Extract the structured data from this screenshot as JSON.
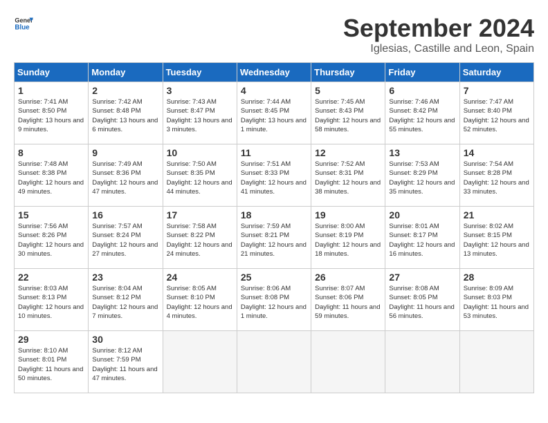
{
  "logo": {
    "line1": "General",
    "line2": "Blue"
  },
  "title": "September 2024",
  "location": "Iglesias, Castille and Leon, Spain",
  "days_of_week": [
    "Sunday",
    "Monday",
    "Tuesday",
    "Wednesday",
    "Thursday",
    "Friday",
    "Saturday"
  ],
  "weeks": [
    [
      {
        "day": "1",
        "sunrise": "7:41 AM",
        "sunset": "8:50 PM",
        "daylight": "13 hours and 9 minutes."
      },
      {
        "day": "2",
        "sunrise": "7:42 AM",
        "sunset": "8:48 PM",
        "daylight": "13 hours and 6 minutes."
      },
      {
        "day": "3",
        "sunrise": "7:43 AM",
        "sunset": "8:47 PM",
        "daylight": "13 hours and 3 minutes."
      },
      {
        "day": "4",
        "sunrise": "7:44 AM",
        "sunset": "8:45 PM",
        "daylight": "13 hours and 1 minute."
      },
      {
        "day": "5",
        "sunrise": "7:45 AM",
        "sunset": "8:43 PM",
        "daylight": "12 hours and 58 minutes."
      },
      {
        "day": "6",
        "sunrise": "7:46 AM",
        "sunset": "8:42 PM",
        "daylight": "12 hours and 55 minutes."
      },
      {
        "day": "7",
        "sunrise": "7:47 AM",
        "sunset": "8:40 PM",
        "daylight": "12 hours and 52 minutes."
      }
    ],
    [
      {
        "day": "8",
        "sunrise": "7:48 AM",
        "sunset": "8:38 PM",
        "daylight": "12 hours and 49 minutes."
      },
      {
        "day": "9",
        "sunrise": "7:49 AM",
        "sunset": "8:36 PM",
        "daylight": "12 hours and 47 minutes."
      },
      {
        "day": "10",
        "sunrise": "7:50 AM",
        "sunset": "8:35 PM",
        "daylight": "12 hours and 44 minutes."
      },
      {
        "day": "11",
        "sunrise": "7:51 AM",
        "sunset": "8:33 PM",
        "daylight": "12 hours and 41 minutes."
      },
      {
        "day": "12",
        "sunrise": "7:52 AM",
        "sunset": "8:31 PM",
        "daylight": "12 hours and 38 minutes."
      },
      {
        "day": "13",
        "sunrise": "7:53 AM",
        "sunset": "8:29 PM",
        "daylight": "12 hours and 35 minutes."
      },
      {
        "day": "14",
        "sunrise": "7:54 AM",
        "sunset": "8:28 PM",
        "daylight": "12 hours and 33 minutes."
      }
    ],
    [
      {
        "day": "15",
        "sunrise": "7:56 AM",
        "sunset": "8:26 PM",
        "daylight": "12 hours and 30 minutes."
      },
      {
        "day": "16",
        "sunrise": "7:57 AM",
        "sunset": "8:24 PM",
        "daylight": "12 hours and 27 minutes."
      },
      {
        "day": "17",
        "sunrise": "7:58 AM",
        "sunset": "8:22 PM",
        "daylight": "12 hours and 24 minutes."
      },
      {
        "day": "18",
        "sunrise": "7:59 AM",
        "sunset": "8:21 PM",
        "daylight": "12 hours and 21 minutes."
      },
      {
        "day": "19",
        "sunrise": "8:00 AM",
        "sunset": "8:19 PM",
        "daylight": "12 hours and 18 minutes."
      },
      {
        "day": "20",
        "sunrise": "8:01 AM",
        "sunset": "8:17 PM",
        "daylight": "12 hours and 16 minutes."
      },
      {
        "day": "21",
        "sunrise": "8:02 AM",
        "sunset": "8:15 PM",
        "daylight": "12 hours and 13 minutes."
      }
    ],
    [
      {
        "day": "22",
        "sunrise": "8:03 AM",
        "sunset": "8:13 PM",
        "daylight": "12 hours and 10 minutes."
      },
      {
        "day": "23",
        "sunrise": "8:04 AM",
        "sunset": "8:12 PM",
        "daylight": "12 hours and 7 minutes."
      },
      {
        "day": "24",
        "sunrise": "8:05 AM",
        "sunset": "8:10 PM",
        "daylight": "12 hours and 4 minutes."
      },
      {
        "day": "25",
        "sunrise": "8:06 AM",
        "sunset": "8:08 PM",
        "daylight": "12 hours and 1 minute."
      },
      {
        "day": "26",
        "sunrise": "8:07 AM",
        "sunset": "8:06 PM",
        "daylight": "11 hours and 59 minutes."
      },
      {
        "day": "27",
        "sunrise": "8:08 AM",
        "sunset": "8:05 PM",
        "daylight": "11 hours and 56 minutes."
      },
      {
        "day": "28",
        "sunrise": "8:09 AM",
        "sunset": "8:03 PM",
        "daylight": "11 hours and 53 minutes."
      }
    ],
    [
      {
        "day": "29",
        "sunrise": "8:10 AM",
        "sunset": "8:01 PM",
        "daylight": "11 hours and 50 minutes."
      },
      {
        "day": "30",
        "sunrise": "8:12 AM",
        "sunset": "7:59 PM",
        "daylight": "11 hours and 47 minutes."
      },
      null,
      null,
      null,
      null,
      null
    ]
  ]
}
